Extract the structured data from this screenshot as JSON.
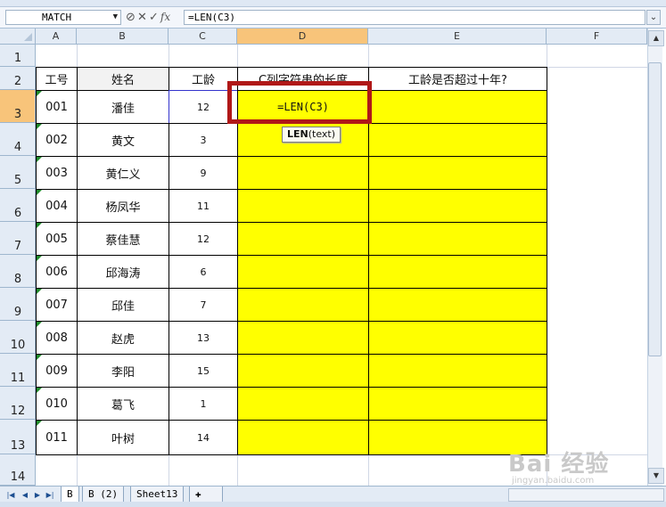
{
  "formula_bar": {
    "name_box": "MATCH",
    "buttons": [
      "⊘",
      "✕",
      "✓",
      "fx"
    ],
    "formula": "=LEN(C3)"
  },
  "columns": [
    "A",
    "B",
    "C",
    "D",
    "E",
    "F"
  ],
  "rows": [
    "1",
    "2",
    "3",
    "4",
    "5",
    "6",
    "7",
    "8",
    "9",
    "10",
    "11",
    "12",
    "13",
    "14"
  ],
  "table": {
    "headers": [
      "工号",
      "姓名",
      "工龄",
      "C列字符串的长度",
      "工龄是否超过十年?"
    ],
    "rows": [
      [
        "001",
        "潘佳",
        "12",
        "=LEN(C3)",
        ""
      ],
      [
        "002",
        "黄文",
        "3",
        "",
        ""
      ],
      [
        "003",
        "黄仁义",
        "9",
        "",
        ""
      ],
      [
        "004",
        "杨凤华",
        "11",
        "",
        ""
      ],
      [
        "005",
        "蔡佳慧",
        "12",
        "",
        ""
      ],
      [
        "006",
        "邱海涛",
        "6",
        "",
        ""
      ],
      [
        "007",
        "邱佳",
        "7",
        "",
        ""
      ],
      [
        "008",
        "赵虎",
        "13",
        "",
        ""
      ],
      [
        "009",
        "李阳",
        "15",
        "",
        ""
      ],
      [
        "010",
        "葛飞",
        "1",
        "",
        ""
      ],
      [
        "011",
        "叶树",
        "14",
        "",
        ""
      ]
    ]
  },
  "tooltip": {
    "func": "LEN",
    "args": "(text)"
  },
  "sheet_tabs": [
    "B",
    "B (2)",
    "Sheet13"
  ],
  "active_tab": "B",
  "colors": {
    "highlight": "#ffff00",
    "annotation": "#b01818",
    "selected_header": "#f8c47a"
  },
  "watermark": {
    "main": "Bai 经验",
    "sub": "jingyan.baidu.com"
  }
}
